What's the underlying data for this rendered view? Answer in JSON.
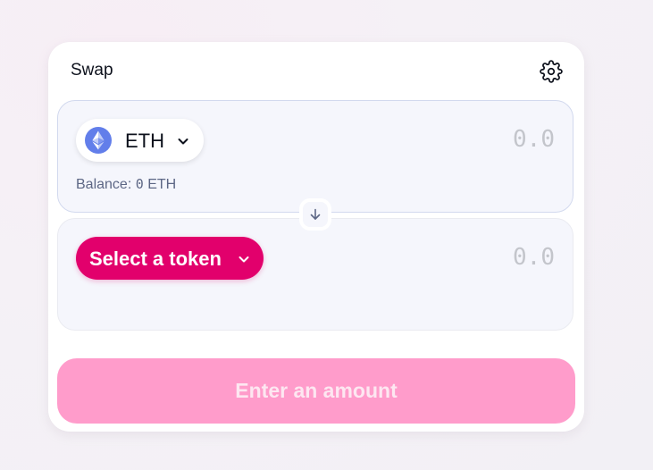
{
  "swap": {
    "title": "Swap",
    "settings_icon": "gear-icon"
  },
  "input": {
    "token_symbol": "ETH",
    "token_icon": "ethereum-icon",
    "amount_placeholder": "0.0",
    "balance_label": "Balance:",
    "balance_value": "0",
    "balance_unit": "ETH"
  },
  "switch": {
    "icon": "arrow-down-icon"
  },
  "output": {
    "select_label": "Select a token",
    "amount_placeholder": "0.0"
  },
  "action": {
    "button_label": "Enter an amount"
  },
  "colors": {
    "accent_pink": "#e2006c",
    "cta_disabled": "#ff9ccb",
    "eth_blue": "#627eea"
  }
}
